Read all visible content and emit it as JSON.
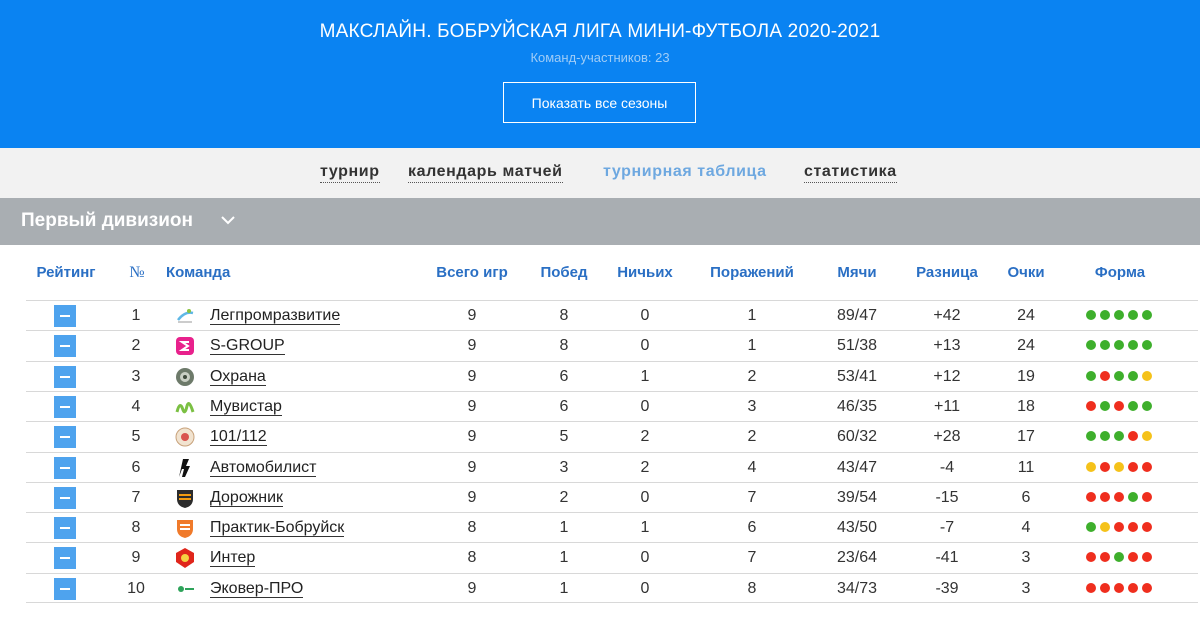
{
  "header": {
    "title": "МАКСЛАЙН. БОБРУЙСКАЯ ЛИГА МИНИ-ФУТБОЛА 2020-2021",
    "subtitle": "Команд-участников: 23",
    "seasons_button": "Показать все сезоны"
  },
  "nav": {
    "items": [
      {
        "label": "турнир",
        "active": false
      },
      {
        "label": "календарь матчей",
        "active": false
      },
      {
        "label": "турнирная таблица",
        "active": true
      },
      {
        "label": "статистика",
        "active": false
      }
    ]
  },
  "division": {
    "name": "Первый дивизион"
  },
  "table": {
    "headers": {
      "rating": "Рейтинг",
      "number": "№",
      "team": "Команда",
      "games": "Всего игр",
      "wins": "Побед",
      "draws": "Ничьих",
      "losses": "Поражений",
      "goals": "Мячи",
      "diff": "Разница",
      "points": "Очки",
      "form": "Форма"
    },
    "rows": [
      {
        "pos": "1",
        "team": "Легпромразвитие",
        "logo": "legprom-logo-icon",
        "games": "9",
        "wins": "8",
        "draws": "0",
        "losses": "1",
        "goals": "89/47",
        "diff": "+42",
        "points": "24",
        "form": [
          "w",
          "w",
          "w",
          "w",
          "w"
        ]
      },
      {
        "pos": "2",
        "team": "S-GROUP",
        "logo": "s-group-logo-icon",
        "games": "9",
        "wins": "8",
        "draws": "0",
        "losses": "1",
        "goals": "51/38",
        "diff": "+13",
        "points": "24",
        "form": [
          "w",
          "w",
          "w",
          "w",
          "w"
        ]
      },
      {
        "pos": "3",
        "team": "Охрана",
        "logo": "ohrana-logo-icon",
        "games": "9",
        "wins": "6",
        "draws": "1",
        "losses": "2",
        "goals": "53/41",
        "diff": "+12",
        "points": "19",
        "form": [
          "w",
          "l",
          "w",
          "w",
          "d"
        ]
      },
      {
        "pos": "4",
        "team": "Мувистар",
        "logo": "movistar-logo-icon",
        "games": "9",
        "wins": "6",
        "draws": "0",
        "losses": "3",
        "goals": "46/35",
        "diff": "+11",
        "points": "18",
        "form": [
          "l",
          "w",
          "l",
          "w",
          "w"
        ]
      },
      {
        "pos": "5",
        "team": "101/112",
        "logo": "101-112-logo-icon",
        "games": "9",
        "wins": "5",
        "draws": "2",
        "losses": "2",
        "goals": "60/32",
        "diff": "+28",
        "points": "17",
        "form": [
          "w",
          "w",
          "w",
          "l",
          "d"
        ]
      },
      {
        "pos": "6",
        "team": "Автомобилист",
        "logo": "avtomobilist-logo-icon",
        "games": "9",
        "wins": "3",
        "draws": "2",
        "losses": "4",
        "goals": "43/47",
        "diff": "-4",
        "points": "11",
        "form": [
          "d",
          "l",
          "d",
          "l",
          "l"
        ]
      },
      {
        "pos": "7",
        "team": "Дорожник",
        "logo": "dorozhnik-logo-icon",
        "games": "9",
        "wins": "2",
        "draws": "0",
        "losses": "7",
        "goals": "39/54",
        "diff": "-15",
        "points": "6",
        "form": [
          "l",
          "l",
          "l",
          "w",
          "l"
        ]
      },
      {
        "pos": "8",
        "team": "Практик-Бобруйск",
        "logo": "praktik-logo-icon",
        "games": "8",
        "wins": "1",
        "draws": "1",
        "losses": "6",
        "goals": "43/50",
        "diff": "-7",
        "points": "4",
        "form": [
          "w",
          "d",
          "l",
          "l",
          "l"
        ]
      },
      {
        "pos": "9",
        "team": "Интер",
        "logo": "inter-logo-icon",
        "games": "8",
        "wins": "1",
        "draws": "0",
        "losses": "7",
        "goals": "23/64",
        "diff": "-41",
        "points": "3",
        "form": [
          "l",
          "l",
          "w",
          "l",
          "l"
        ]
      },
      {
        "pos": "10",
        "team": "Эковер-ПРО",
        "logo": "ekover-logo-icon",
        "games": "9",
        "wins": "1",
        "draws": "0",
        "losses": "8",
        "goals": "34/73",
        "diff": "-39",
        "points": "3",
        "form": [
          "l",
          "l",
          "l",
          "l",
          "l"
        ]
      }
    ]
  },
  "colors": {
    "header_bg": "#0a83f2",
    "division_bg": "#a9aeb2",
    "accent": "#2a6fc4",
    "win": "#3eaf2c",
    "loss": "#ef2e1e",
    "draw": "#f5c21a"
  }
}
